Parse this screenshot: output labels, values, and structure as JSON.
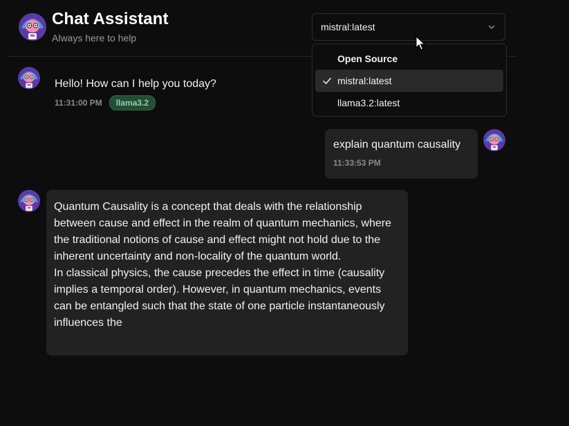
{
  "header": {
    "title": "Chat Assistant",
    "subtitle": "Always here to help"
  },
  "model_select": {
    "value": "mistral:latest",
    "icon": "chevron-down-icon"
  },
  "dropdown": {
    "group_label": "Open Source",
    "options": [
      {
        "label": "mistral:latest",
        "selected": true
      },
      {
        "label": "llama3.2:latest",
        "selected": false
      }
    ]
  },
  "messages": [
    {
      "role": "assistant",
      "text": "Hello! How can I help you today?",
      "time": "11:31:00 PM",
      "model": "llama3.2"
    },
    {
      "role": "user",
      "text": "explain quantum causality",
      "time": "11:33:53 PM"
    },
    {
      "role": "assistant",
      "paragraphs": [
        "Quantum Causality is a concept that deals with the relationship between cause and effect in the realm of quantum mechanics, where the traditional notions of cause and effect might not hold due to the inherent uncertainty and non-locality of the quantum world.",
        "In classical physics, the cause precedes the effect in time (causality implies a temporal order). However, in quantum mechanics, events can be entangled such that the state of one particle instantaneously influences the"
      ]
    }
  ],
  "colors": {
    "background": "#0d0d0d",
    "bubble": "#222222",
    "badge_bg": "#244c36",
    "badge_text": "#8fd0a8"
  }
}
